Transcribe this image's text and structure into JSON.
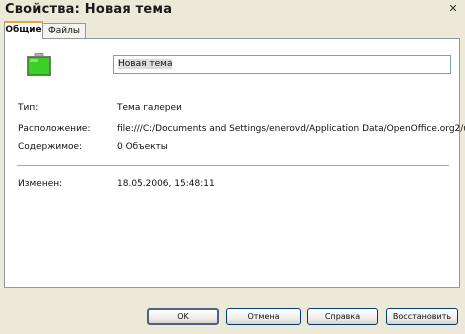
{
  "window": {
    "title": "Свойства: Новая тема",
    "close_glyph": "✕"
  },
  "tabs": [
    {
      "label": "Общие",
      "active": true
    },
    {
      "label": "Файлы",
      "active": false
    }
  ],
  "general": {
    "theme_name": "Новая тема",
    "type_label": "Тип:",
    "type_value": "Тема галереи",
    "location_label": "Расположение:",
    "location_value": "file:///C:/Documents and Settings/enerovd/Application Data/OpenOffice.org2/u",
    "contents_label": "Содержимое:",
    "contents_value": "0 Объекты",
    "modified_label": "Изменен:",
    "modified_value": "18.05.2006, 15:48:11"
  },
  "buttons": {
    "ok": "OK",
    "cancel": "Отмена",
    "help": "Справка",
    "reset": "Восстановить"
  },
  "icons": {
    "theme": "gallery-theme-icon",
    "close": "close-icon"
  },
  "colors": {
    "dialog_bg": "#ece9d8",
    "tab_accent": "#e8a33b",
    "theme_icon_fill": "#3fcf2a"
  }
}
